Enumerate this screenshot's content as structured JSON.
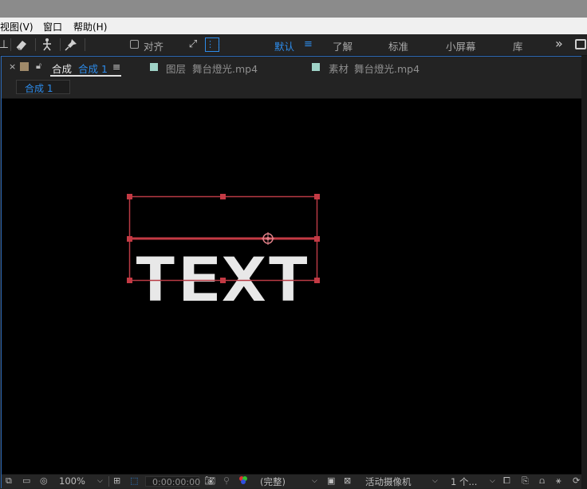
{
  "menubar": {
    "items": [
      "视图(V)",
      "窗口",
      "帮助(H)"
    ]
  },
  "toolbar": {
    "align_label": "对齐",
    "workspaces": [
      "默认",
      "了解",
      "标准",
      "小屏幕",
      "库"
    ],
    "active_workspace": "默认",
    "more": "»",
    "icons": [
      "pin-tool-icon",
      "eraser-tool-icon",
      "puppet-tool-icon",
      "puppet-pin-icon",
      "snap-icon",
      "snap-target-icon",
      "workspace-menu-icon"
    ]
  },
  "panel": {
    "close": "×",
    "comp_tab": {
      "prefix": "合成",
      "name": "合成 1",
      "menu": "≡"
    },
    "layer_tab": {
      "prefix": "图层",
      "name": "舞台燈光.mp4"
    },
    "footage_tab": {
      "prefix": "素材",
      "name": "舞台燈光.mp4"
    },
    "breadcrumb": "合成 1",
    "colors": {
      "comp_swatch": "#a08a6a",
      "layer_swatch": "#9fd3c7",
      "footage_swatch": "#9fd3c7",
      "accent": "#2d8ceb",
      "handle": "#c43a44"
    }
  },
  "viewer": {
    "layer_text": "TEXT"
  },
  "bottombar": {
    "zoom": "100%",
    "timecode": "0:00:00:00",
    "resolution": "(完整)",
    "camera": "活动摄像机",
    "views": "1 个..."
  }
}
